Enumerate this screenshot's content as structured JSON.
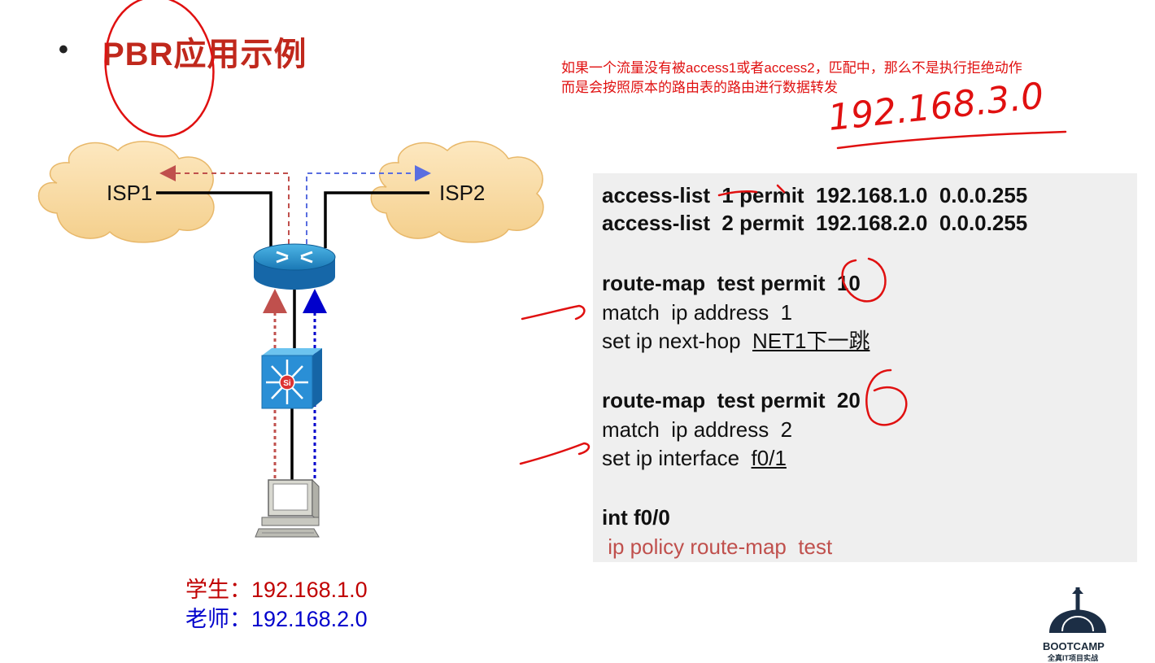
{
  "slide": {
    "bullet": "•",
    "title": "PBR应用示例",
    "note_lines": [
      "如果一个流量没有被access1或者access2，匹配中，那么不是执行拒绝动作",
      "而是会按照原本的路由表的路由进行数据转发"
    ],
    "handwritten_ip": "192.168.3.0"
  },
  "diagram": {
    "isp1_label": "ISP1",
    "isp2_label": "ISP2",
    "switch_badge": "Si",
    "legend": {
      "student": "学生：192.168.1.0",
      "teacher": "老师：192.168.2.0"
    },
    "colors": {
      "student": "#c0504d",
      "teacher": "#0000cc",
      "annotation": "#e01010",
      "router": "#1f8fc8"
    }
  },
  "config": {
    "acl1": "access-list  1 permit  192.168.1.0  0.0.0.255",
    "acl2": "access-list  2 permit  192.168.2.0  0.0.0.255",
    "rm10_header": "route-map  test permit  10",
    "rm10_match": "match  ip address  1",
    "rm10_set_prefix": "set ip next-hop  ",
    "rm10_set_value": "NET1下一跳",
    "rm20_header": "route-map  test permit  20",
    "rm20_match": "match  ip address  2",
    "rm20_set_prefix": "set ip interface  ",
    "rm20_set_value": "f0/1",
    "int_line": "int f0/0",
    "policy_line": " ip policy route-map  test"
  },
  "logo": {
    "brand": "BOOTCAMP",
    "subtitle": "全真IT项目实战"
  }
}
